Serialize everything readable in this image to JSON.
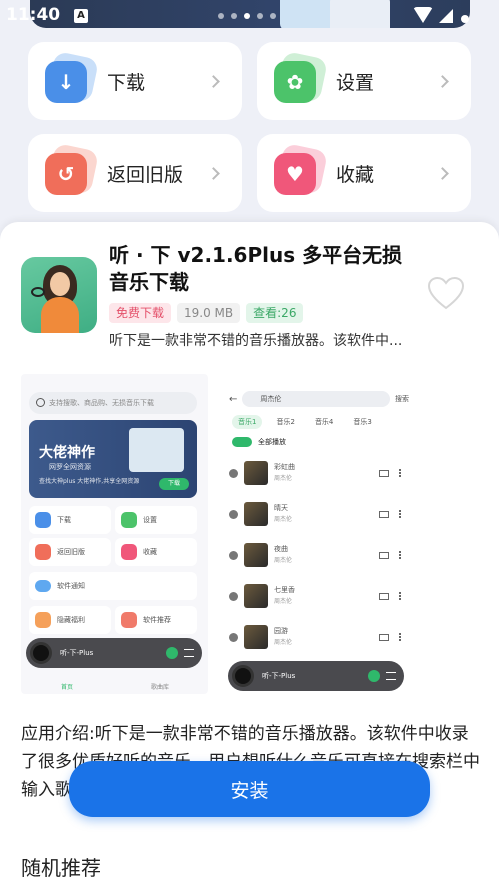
{
  "status_bar": {
    "time": "11:40",
    "a_badge": "A"
  },
  "menu": {
    "download": {
      "label": "下载",
      "icon": "download-icon",
      "color": "#4a8fe8"
    },
    "settings": {
      "label": "设置",
      "icon": "gear-icon",
      "color": "#4cc36a"
    },
    "old_version": {
      "label": "返回旧版",
      "icon": "undo-icon",
      "color": "#f06e5a"
    },
    "favorites": {
      "label": "收藏",
      "icon": "heart-icon",
      "color": "#f0577a"
    }
  },
  "app": {
    "title": "听 · 下 v2.1.6Plus 多平台无损音乐下载",
    "tag_free": "免费下载",
    "tag_size": "19.0 MB",
    "tag_views": "查看:26",
    "short_desc": "听下是一款非常不错的音乐播放器。该软件中..."
  },
  "screenshot1": {
    "search_placeholder": "支持搜歌、商品购、无损音乐下载",
    "banner_title": "大佬神作",
    "banner_sub": "网罗全网资源",
    "banner_tiny": "查找大神plus 大佬神作,共享全网资源",
    "banner_btn": "下载",
    "items": [
      "下载",
      "设置",
      "返回旧版",
      "收藏"
    ],
    "notice": "软件通知",
    "bottom_left": "隐藏福利",
    "bottom_right": "软件推荐",
    "player": "听-下-Plus",
    "nav_home": "首页",
    "nav_other": "歌曲库"
  },
  "screenshot2": {
    "search_value": "周杰伦",
    "search_btn": "搜索",
    "tabs": [
      "音乐1",
      "音乐2",
      "音乐4",
      "音乐3"
    ],
    "play_all": "全部播放",
    "songs": [
      {
        "title": "彩虹曲",
        "artist": "周杰伦"
      },
      {
        "title": "晴天",
        "artist": "周杰伦"
      },
      {
        "title": "夜曲",
        "artist": "周杰伦"
      },
      {
        "title": "七里香",
        "artist": "周杰伦"
      },
      {
        "title": "园游",
        "artist": "周杰伦"
      }
    ],
    "player": "听-下-Plus"
  },
  "intro": "应用介绍:听下是一款非常不错的音乐播放器。该软件中收录了很多优质好听的音乐，用户想听什么音乐可直接在搜索栏中输入歌名或歌手名称进行搜索，软件会帮你进行查找。",
  "install_label": "安装",
  "recommend_title": "随机推荐",
  "colors": {
    "install": "#1a73e8",
    "accent_green": "#2fb86b"
  }
}
